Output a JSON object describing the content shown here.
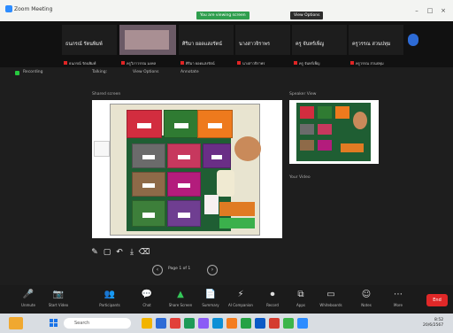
{
  "window": {
    "app_title": "Zoom Meeting",
    "pills": [
      {
        "label": "You are viewing screen",
        "color": "#2f9e4e"
      },
      {
        "label": "View Options",
        "color": "#2c2c2c"
      }
    ],
    "controls": [
      "–",
      "□",
      "×"
    ]
  },
  "gallery": {
    "participants": [
      {
        "name": "ธนภรณ์ รัตนพิมพ์",
        "sub": "ธนภรณ์ รัตนพิมพ์"
      },
      {
        "name": "",
        "sub": "ครูวิภาวรรณ มงคล"
      },
      {
        "name": "ศิริมา ยอดแสงรัตน์",
        "sub": "ศิริมา ยอดแสงรัตน์"
      },
      {
        "name": "นางสาวจิราพร",
        "sub": "นางสาวจิราพร"
      },
      {
        "name": "ครู จันทร์เพ็ญ",
        "sub": "ครู จันทร์เพ็ญ"
      },
      {
        "name": "ครูวรรณ สวนปทุม",
        "sub": "ครูวรรณ สวนปทุม"
      }
    ]
  },
  "status": {
    "recording": "Recording",
    "items": [
      "Talking:",
      "View Options",
      "Annotate"
    ]
  },
  "share": {
    "label": "Shared screen"
  },
  "selfview": {
    "header": "Speaker View",
    "footer": "Your Video"
  },
  "annotate": [
    "✎",
    "▢",
    "↶",
    "⤓",
    "⌫"
  ],
  "pager": {
    "text": "Page 1 of 1"
  },
  "toolbar": {
    "items": [
      {
        "icon": "🎤",
        "label": "Unmute"
      },
      {
        "icon": "📷",
        "label": "Start Video"
      },
      {
        "icon": "👥",
        "label": "Participants"
      },
      {
        "icon": "💬",
        "label": "Chat"
      },
      {
        "icon": "▲",
        "label": "Share Screen"
      },
      {
        "icon": "📄",
        "label": "Summary"
      },
      {
        "icon": "⚡",
        "label": "AI Companion"
      },
      {
        "icon": "⏺",
        "label": "Record"
      },
      {
        "icon": "⧉",
        "label": "Apps"
      },
      {
        "icon": "▭",
        "label": "Whiteboards"
      },
      {
        "icon": "☺",
        "label": "Notes"
      },
      {
        "icon": "⋯",
        "label": "More"
      }
    ],
    "end": "End"
  },
  "taskbar": {
    "search": "Search",
    "time": "8:52",
    "date": "20/6/2567",
    "app_colors": [
      "#f2b400",
      "#2d6bd6",
      "#e2403a",
      "#1e9a57",
      "#8b5cf6",
      "#0d8fd6",
      "#f47d20",
      "#25a244",
      "#0b5ac6",
      "#d43c2f",
      "#3bb54a",
      "#2d8cff"
    ]
  }
}
